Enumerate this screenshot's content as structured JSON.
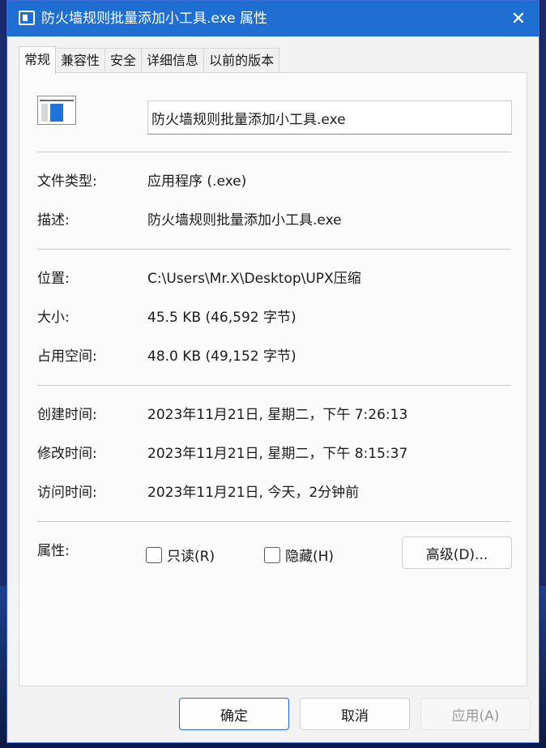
{
  "window": {
    "title": "防火墙规则批量添加小工具.exe 属性",
    "accent_color": "#1f6fd2",
    "icon": "window-icon",
    "close_icon": "close-icon"
  },
  "tabs": [
    {
      "label": "常规",
      "active": true
    },
    {
      "label": "兼容性",
      "active": false
    },
    {
      "label": "安全",
      "active": false
    },
    {
      "label": "详细信息",
      "active": false
    },
    {
      "label": "以前的版本",
      "active": false
    }
  ],
  "general": {
    "file_name": "防火墙规则批量添加小工具.exe",
    "file_icon": "app-file-icon",
    "file_type_label": "文件类型:",
    "file_type_value": "应用程序 (.exe)",
    "description_label": "描述:",
    "description_value": "防火墙规则批量添加小工具.exe",
    "location_label": "位置:",
    "location_value": "C:\\Users\\Mr.X\\Desktop\\UPX压缩",
    "size_label": "大小:",
    "size_value": "45.5 KB (46,592 字节)",
    "size_on_disk_label": "占用空间:",
    "size_on_disk_value": "48.0 KB (49,152 字节)",
    "created_label": "创建时间:",
    "created_value": "2023年11月21日, 星期二，下午 7:26:13",
    "modified_label": "修改时间:",
    "modified_value": "2023年11月21日, 星期二，下午 8:15:37",
    "accessed_label": "访问时间:",
    "accessed_value": "2023年11月21日, 今天，2分钟前",
    "attributes_label": "属性:",
    "readonly_label": "只读(R)",
    "readonly_checked": false,
    "hidden_label": "隐藏(H)",
    "hidden_checked": false,
    "advanced_label": "高级(D)..."
  },
  "footer": {
    "ok_label": "确定",
    "cancel_label": "取消",
    "apply_label": "应用(A)"
  }
}
